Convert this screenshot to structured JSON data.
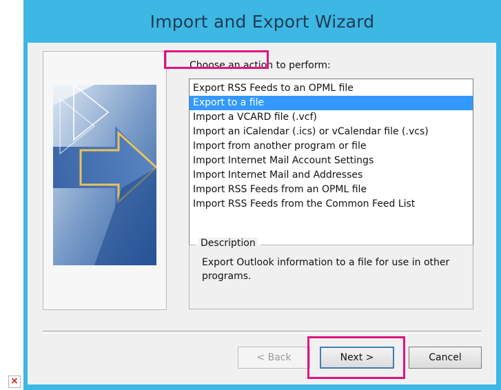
{
  "window": {
    "title": "Import and Export Wizard"
  },
  "main": {
    "prompt": "Choose an action to perform:",
    "actions": [
      {
        "label": "Export RSS Feeds to an OPML file",
        "selected": false
      },
      {
        "label": "Export to a file",
        "selected": true
      },
      {
        "label": "Import a VCARD file (.vcf)",
        "selected": false
      },
      {
        "label": "Import an iCalendar (.ics) or vCalendar file (.vcs)",
        "selected": false
      },
      {
        "label": "Import from another program or file",
        "selected": false
      },
      {
        "label": "Import Internet Mail Account Settings",
        "selected": false
      },
      {
        "label": "Import Internet Mail and Addresses",
        "selected": false
      },
      {
        "label": "Import RSS Feeds from an OPML file",
        "selected": false
      },
      {
        "label": "Import RSS Feeds from the Common Feed List",
        "selected": false
      }
    ],
    "description": {
      "legend": "Description",
      "text": "Export Outlook information to a file for use in other programs."
    }
  },
  "buttons": {
    "back": "< Back",
    "next": "Next >",
    "cancel": "Cancel"
  },
  "colors": {
    "window_frame": "#3db7e4",
    "selection": "#3399ff",
    "highlight": "#e0147f"
  },
  "icons": {
    "broken_image": "broken-image-icon",
    "wizard_art": "arrow-graphic"
  }
}
